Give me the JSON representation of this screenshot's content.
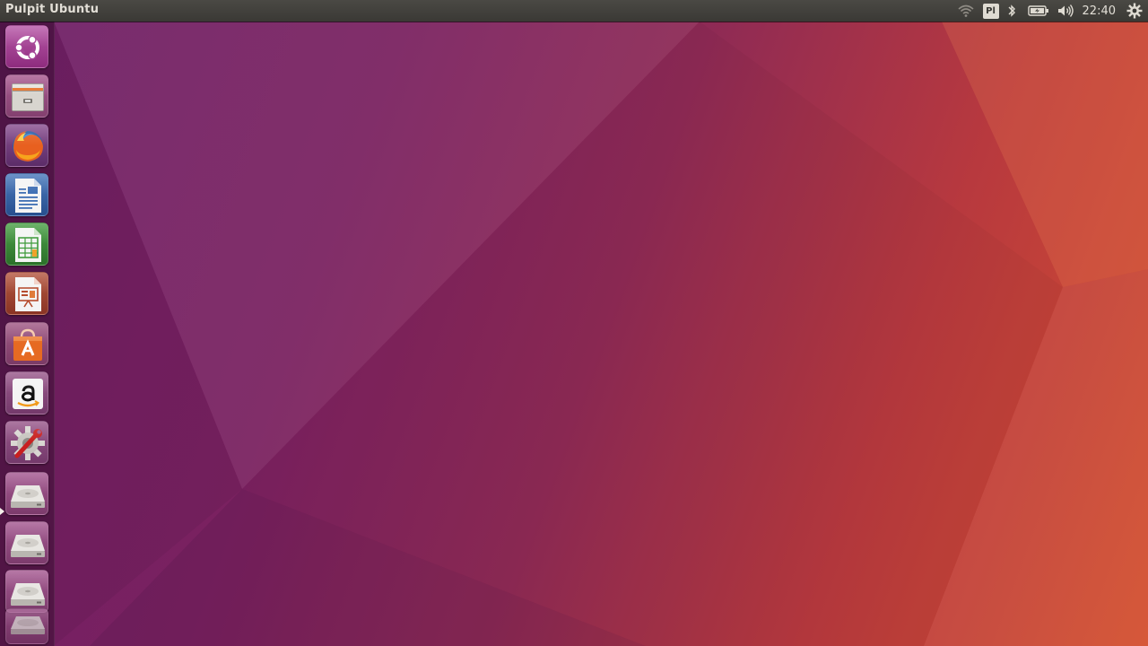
{
  "top_panel": {
    "window_title": "Pulpit Ubuntu",
    "indicators": {
      "wifi_icon": "wifi-icon",
      "keyboard_layout": "Pl",
      "bluetooth_icon": "bluetooth-icon",
      "battery_icon": "battery-icon",
      "sound_icon": "sound-icon",
      "clock": "22:40",
      "session_icon": "gear-icon"
    }
  },
  "launcher": {
    "items": [
      {
        "id": "dash",
        "icon": "ubuntu-logo-icon",
        "active": false
      },
      {
        "id": "files",
        "icon": "file-cabinet-icon",
        "active": false
      },
      {
        "id": "firefox",
        "icon": "firefox-icon",
        "active": false
      },
      {
        "id": "libreoffice-writer",
        "icon": "writer-document-icon",
        "active": false
      },
      {
        "id": "libreoffice-calc",
        "icon": "calc-spreadsheet-icon",
        "active": false
      },
      {
        "id": "libreoffice-impress",
        "icon": "impress-presentation-icon",
        "active": false
      },
      {
        "id": "ubuntu-software",
        "icon": "shopping-bag-icon",
        "active": false
      },
      {
        "id": "amazon",
        "icon": "amazon-icon",
        "active": false
      },
      {
        "id": "system-settings",
        "icon": "settings-gear-wrench-icon",
        "active": false
      },
      {
        "id": "drive-1",
        "icon": "hard-drive-icon",
        "active": true
      },
      {
        "id": "drive-2",
        "icon": "hard-drive-icon",
        "active": false
      },
      {
        "id": "drive-3",
        "icon": "hard-drive-icon",
        "active": false
      },
      {
        "id": "drive-4",
        "icon": "hard-drive-icon",
        "active": false
      }
    ]
  },
  "colors": {
    "panel": "#3c3b37",
    "wallpaper_purple": "#6e1f66",
    "wallpaper_orange": "#d4502f"
  }
}
